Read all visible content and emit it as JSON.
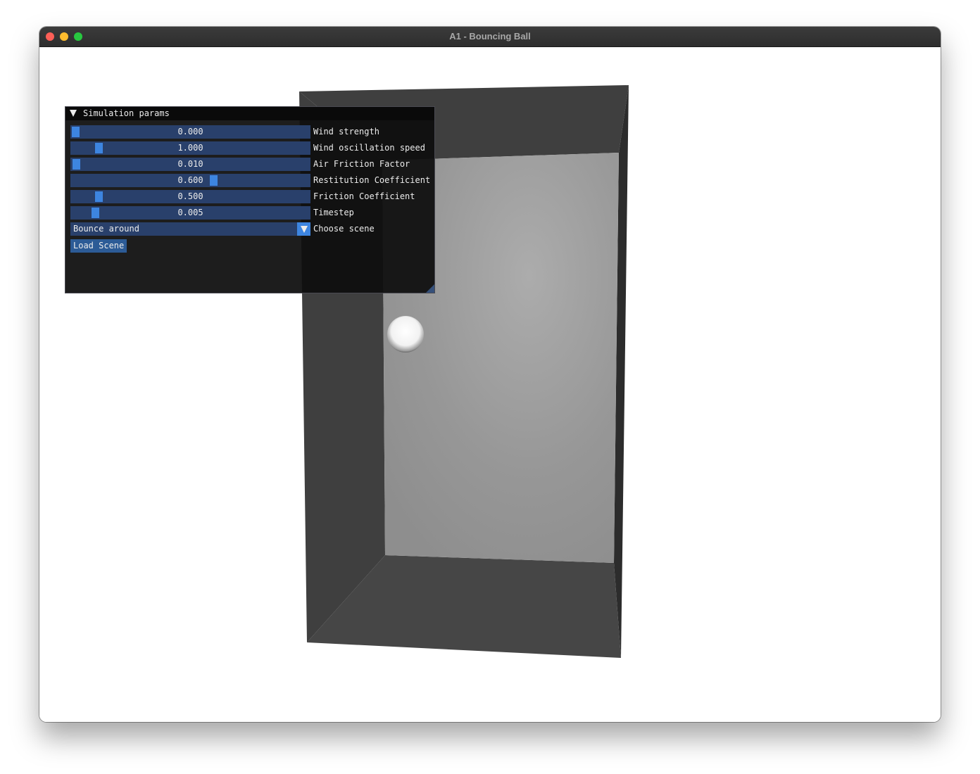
{
  "window": {
    "title": "A1 - Bouncing Ball"
  },
  "panel": {
    "title": "Simulation params",
    "sliders": [
      {
        "label": "Wind strength",
        "value_text": "0.000",
        "fraction": 0.0
      },
      {
        "label": "Wind oscillation speed",
        "value_text": "1.000",
        "fraction": 0.1
      },
      {
        "label": "Air Friction Factor",
        "value_text": "0.010",
        "fraction": 0.003
      },
      {
        "label": "Restitution Coefficient",
        "value_text": "0.600",
        "fraction": 0.6
      },
      {
        "label": "Friction Coefficient",
        "value_text": "0.500",
        "fraction": 0.1
      },
      {
        "label": "Timestep",
        "value_text": "0.005",
        "fraction": 0.085
      }
    ],
    "combo": {
      "label": "Choose scene",
      "selected": "Bounce around"
    },
    "load_button": "Load Scene"
  },
  "colors": {
    "slider_bg": "#29406b",
    "slider_grab": "#3d85e0",
    "button_bg": "#2c5b96",
    "panel_bg": "#0f0f0f"
  },
  "icons": [
    "collapse-arrow-icon",
    "combo-arrow-icon",
    "resize-grip-icon"
  ]
}
